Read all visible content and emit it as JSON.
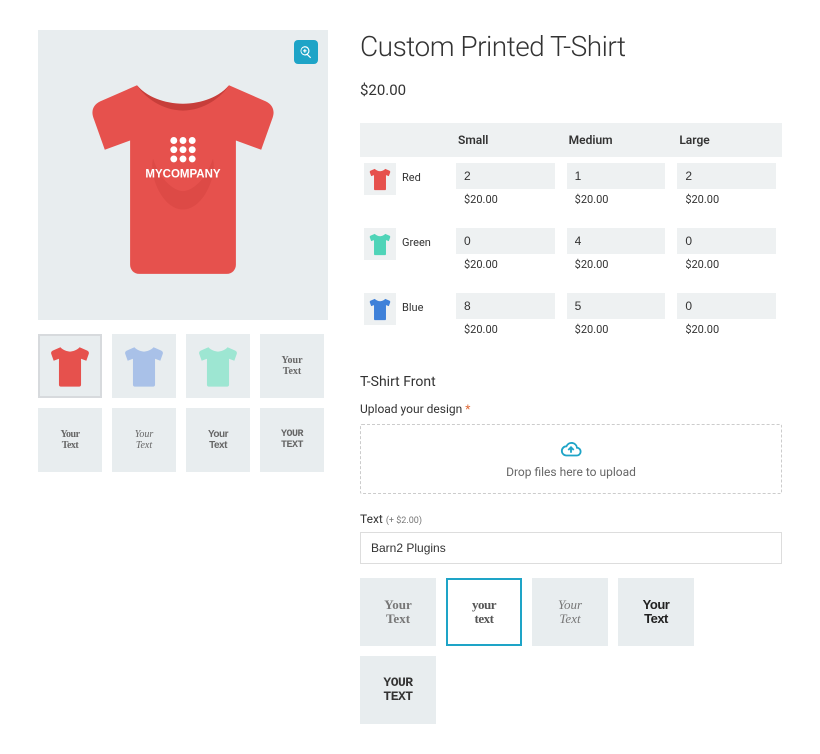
{
  "product": {
    "title": "Custom Printed T-Shirt",
    "price_display": "$20.00",
    "imprint_text": "MYCOMPANY"
  },
  "sizes": [
    "Small",
    "Medium",
    "Large"
  ],
  "colors": [
    {
      "name": "Red",
      "hex": "#e6514d",
      "qty": [
        "2",
        "1",
        "2"
      ],
      "prices": [
        "$20.00",
        "$20.00",
        "$20.00"
      ]
    },
    {
      "name": "Green",
      "hex": "#4fd4b8",
      "qty": [
        "0",
        "4",
        "0"
      ],
      "prices": [
        "$20.00",
        "$20.00",
        "$20.00"
      ]
    },
    {
      "name": "Blue",
      "hex": "#3f81d9",
      "qty": [
        "8",
        "5",
        "0"
      ],
      "prices": [
        "$20.00",
        "$20.00",
        "$20.00"
      ]
    }
  ],
  "front_section": {
    "heading": "T-Shirt Front",
    "upload_label": "Upload your design",
    "dropzone_text": "Drop files here to upload",
    "text_label": "Text",
    "text_price_suffix": "(+ $2.00)",
    "text_value": "Barn2 Plugins"
  },
  "font_options": [
    {
      "id": "f1",
      "label": "Your\nText",
      "cls": "yt-f1",
      "selected": false
    },
    {
      "id": "f2",
      "label": "your\ntext",
      "cls": "yt-f2",
      "selected": true
    },
    {
      "id": "f3",
      "label": "Your\nText",
      "cls": "yt-f3",
      "selected": false
    },
    {
      "id": "f4",
      "label": "Your\nText",
      "cls": "yt-f4",
      "selected": false
    },
    {
      "id": "f5",
      "label": "YOUR\nTEXT",
      "cls": "yt-f5",
      "selected": false
    }
  ],
  "thumbnails": [
    {
      "kind": "shirt",
      "hex": "#e6514d",
      "selected": true
    },
    {
      "kind": "shirt",
      "hex": "#a9c1e8",
      "selected": false
    },
    {
      "kind": "shirt",
      "hex": "#9de6d2",
      "selected": false
    },
    {
      "kind": "text",
      "cls": "yt-f1"
    },
    {
      "kind": "text",
      "cls": "yt-f2"
    },
    {
      "kind": "text",
      "cls": "yt-f3"
    },
    {
      "kind": "text",
      "cls": "yt-f4"
    },
    {
      "kind": "text",
      "cls": "yt-f5"
    }
  ],
  "thumb_text": "Your\nText"
}
